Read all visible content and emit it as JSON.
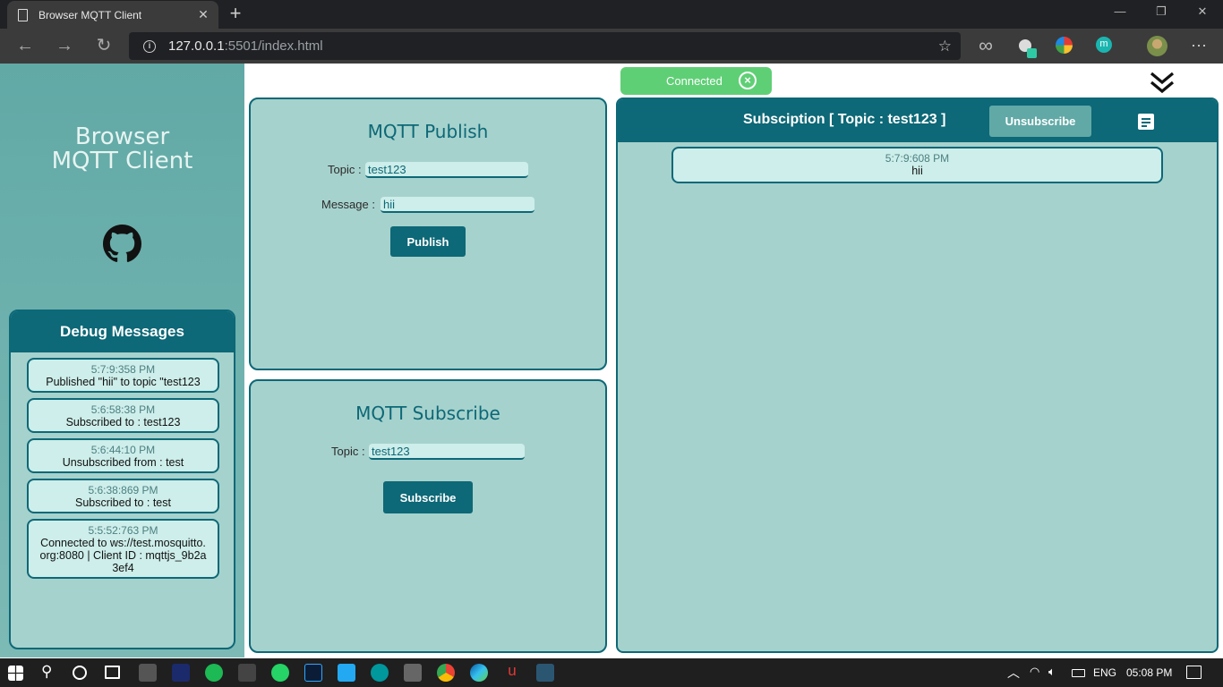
{
  "browser": {
    "tab_title": "Browser MQTT Client",
    "url_host": "127.0.0.1",
    "url_path": ":5501/index.html"
  },
  "sidebar": {
    "brand_line1": "Browser",
    "brand_line2": "MQTT Client",
    "debug": {
      "title": "Debug Messages",
      "items": [
        {
          "time": "5:7:9:358 PM",
          "message": "Published \"hii\" to topic \"test123"
        },
        {
          "time": "5:6:58:38 PM",
          "message": "Subscribed to : test123"
        },
        {
          "time": "5:6:44:10 PM",
          "message": "Unsubscribed from : test"
        },
        {
          "time": "5:6:38:869 PM",
          "message": "Subscribed to : test"
        },
        {
          "time": "5:5:52:763 PM",
          "message": "Connected to ws://test.mosquitto.org:8080 | Client ID : mqttjs_9b2a3ef4"
        }
      ]
    }
  },
  "publish": {
    "title": "MQTT Publish",
    "topic_label": "Topic :",
    "topic_value": "test123",
    "message_label": "Message :",
    "message_value": "hii",
    "button": "Publish"
  },
  "subscribe": {
    "title": "MQTT Subscribe",
    "topic_label": "Topic :",
    "topic_value": "test123",
    "button": "Subscribe"
  },
  "status": {
    "label": "Connected",
    "color": "#5fcf76"
  },
  "subscription": {
    "title": "Subsciption [ Topic : test123 ]",
    "unsubscribe_label": "Unsubscribe",
    "messages": [
      {
        "time": "5:7:9:608 PM",
        "message": "hii"
      }
    ]
  },
  "taskbar": {
    "lang": "ENG",
    "time": "05:08 PM"
  },
  "colors": {
    "accent": "#0d6877",
    "panel": "#a6d2cd",
    "sidebar": "#61a9a6"
  }
}
